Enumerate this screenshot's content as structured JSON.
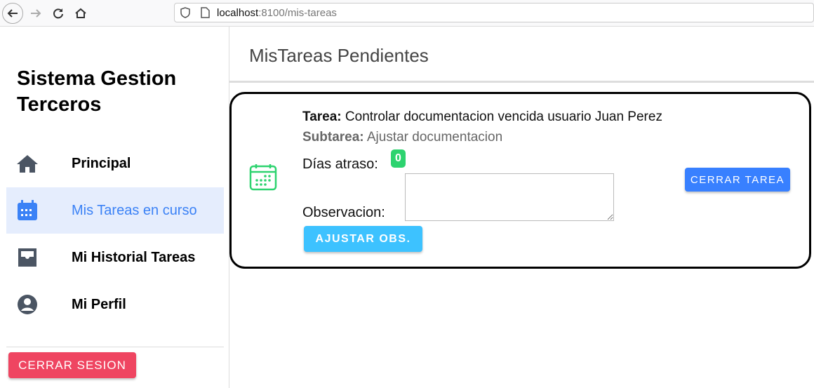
{
  "browser": {
    "url_host": "localhost",
    "url_path": ":8100/mis-tareas"
  },
  "sidebar": {
    "title": "Sistema Gestion Terceros",
    "items": [
      {
        "label": "Principal"
      },
      {
        "label": "Mis Tareas en curso"
      },
      {
        "label": "Mi Historial Tareas"
      },
      {
        "label": "Mi Perfil"
      }
    ],
    "logout": "CERRAR SESION"
  },
  "page": {
    "title": "MisTareas Pendientes"
  },
  "task": {
    "tarea_label": "Tarea:",
    "tarea": " Controlar documentacion vencida usuario Juan Perez",
    "subtarea_label": "Subtarea:",
    "subtarea": " Ajustar documentacion",
    "dias_label": "Días atraso:",
    "dias": "0",
    "obs_label": "Observacion:",
    "obs_value": "",
    "adjust_btn": "AJUSTAR OBS.",
    "close_btn": "CERRAR TAREA"
  }
}
